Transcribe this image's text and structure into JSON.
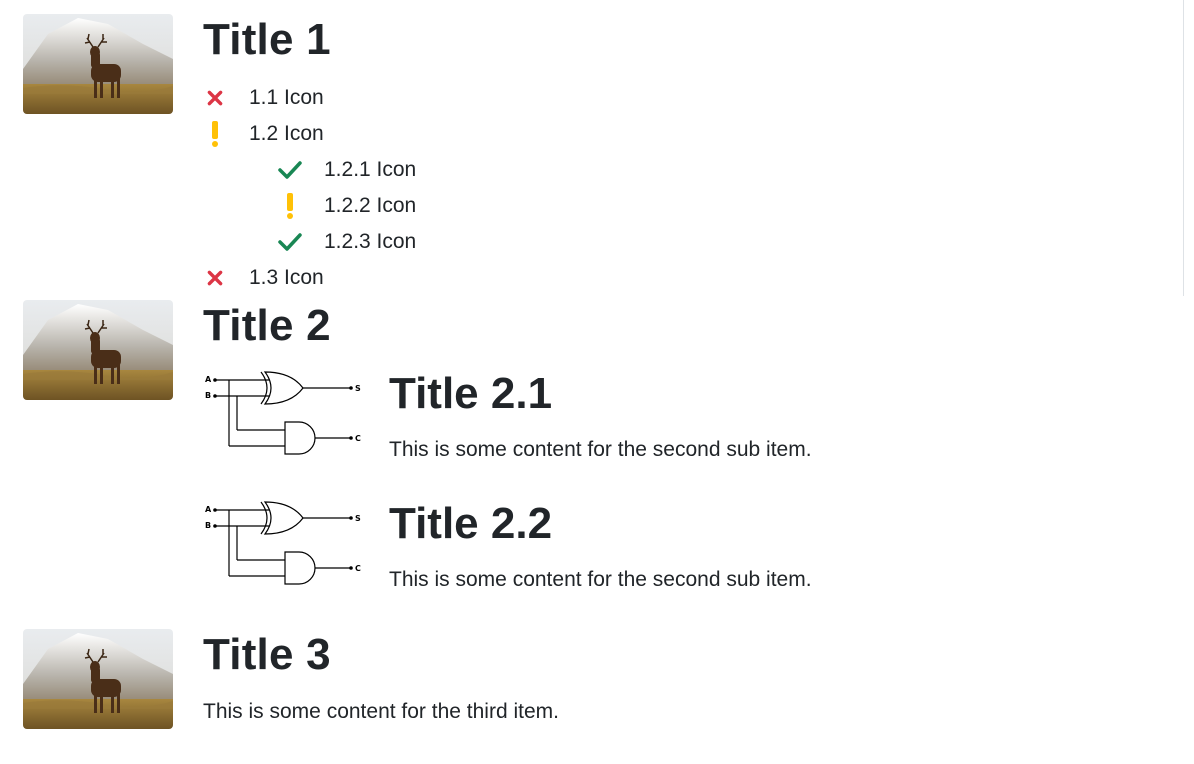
{
  "items": [
    {
      "title": "Title 1",
      "list": [
        {
          "icon": "x-icon",
          "label": "1.1 Icon"
        },
        {
          "icon": "exclamation-icon",
          "label": "1.2 Icon",
          "children": [
            {
              "icon": "check-icon",
              "label": "1.2.1 Icon"
            },
            {
              "icon": "exclamation-icon",
              "label": "1.2.2 Icon"
            },
            {
              "icon": "check-icon",
              "label": "1.2.3 Icon"
            }
          ]
        },
        {
          "icon": "x-icon",
          "label": "1.3 Icon"
        }
      ]
    },
    {
      "title": "Title 2",
      "subs": [
        {
          "title": "Title 2.1",
          "content": "This is some content for the second sub item.",
          "circuit_labels": {
            "a": "A",
            "b": "B",
            "s": "S",
            "c": "C"
          }
        },
        {
          "title": "Title 2.2",
          "content": "This is some content for the second sub item.",
          "circuit_labels": {
            "a": "A",
            "b": "B",
            "s": "S",
            "c": "C"
          }
        }
      ]
    },
    {
      "title": "Title 3",
      "content": "This is some content for the third item."
    }
  ],
  "colors": {
    "x": "#dc3545",
    "exclamation": "#ffc107",
    "check": "#198754",
    "text": "#212529"
  }
}
